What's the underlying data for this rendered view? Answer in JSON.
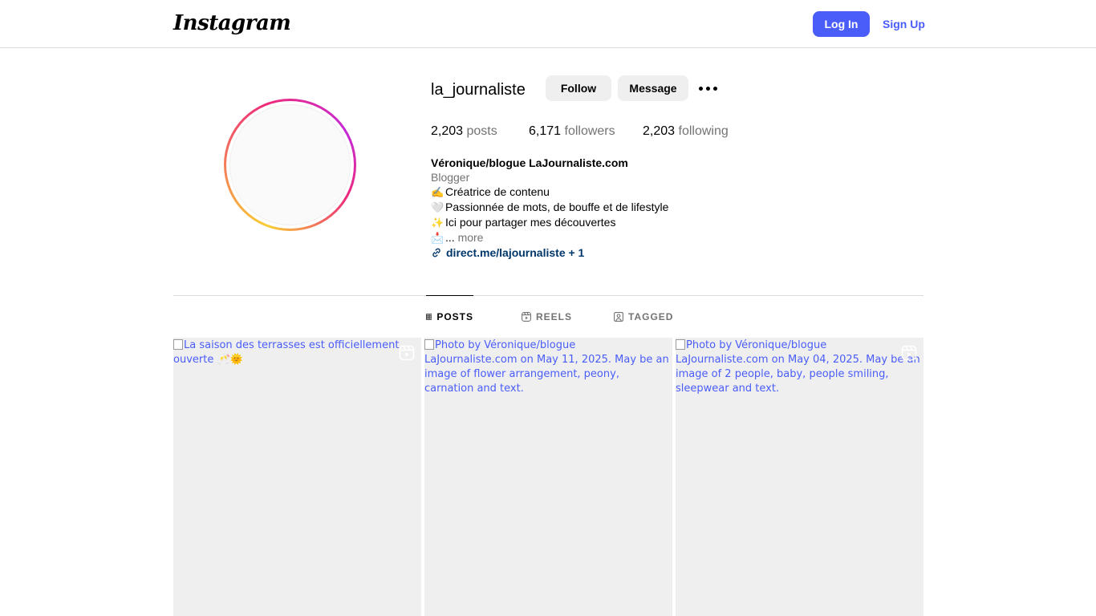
{
  "header": {
    "logo_text": "Instagram",
    "login_label": "Log In",
    "signup_label": "Sign Up"
  },
  "profile": {
    "username": "la_journaliste",
    "follow_label": "Follow",
    "message_label": "Message",
    "stats": {
      "posts_count": "2,203",
      "posts_label": " posts",
      "followers_count": "6,171",
      "followers_label": " followers",
      "following_count": "2,203",
      "following_label": " following"
    },
    "bio": {
      "name": "Véronique/blogue LaJournaliste.com",
      "category": "Blogger",
      "line1_emoji": "✍️",
      "line1": "Créatrice de contenu",
      "line2_emoji": "🤍",
      "line2": "Passionnée de mots, de bouffe et de lifestyle",
      "line3_emoji": "✨",
      "line3": "Ici pour partager mes découvertes",
      "line4_emoji": "📩",
      "ellipsis": "...",
      "more": "more",
      "link": "direct.me/lajournaliste + 1"
    }
  },
  "tabs": [
    {
      "label": "POSTS",
      "icon": "grid-icon",
      "active": true
    },
    {
      "label": "REELS",
      "icon": "reels-icon",
      "active": false
    },
    {
      "label": "TAGGED",
      "icon": "tagged-icon",
      "active": false
    }
  ],
  "posts": [
    {
      "alt": "La saison des terrasses est officiellement ouverte 🥂🌞",
      "is_reel": true
    },
    {
      "alt": "Photo by Véronique/blogue LaJournaliste.com on May 11, 2025. May be an image of flower arrangement, peony, carnation and text.",
      "is_reel": false
    },
    {
      "alt": "Photo by Véronique/blogue LaJournaliste.com on May 04, 2025. May be an image of 2 people, baby, people smiling, sleepwear and text.",
      "is_reel": true
    }
  ],
  "colors": {
    "accent": "#4a5df9",
    "link": "#00376b",
    "muted": "#737373",
    "button_gray": "#efefef",
    "placeholder": "#efefef"
  }
}
